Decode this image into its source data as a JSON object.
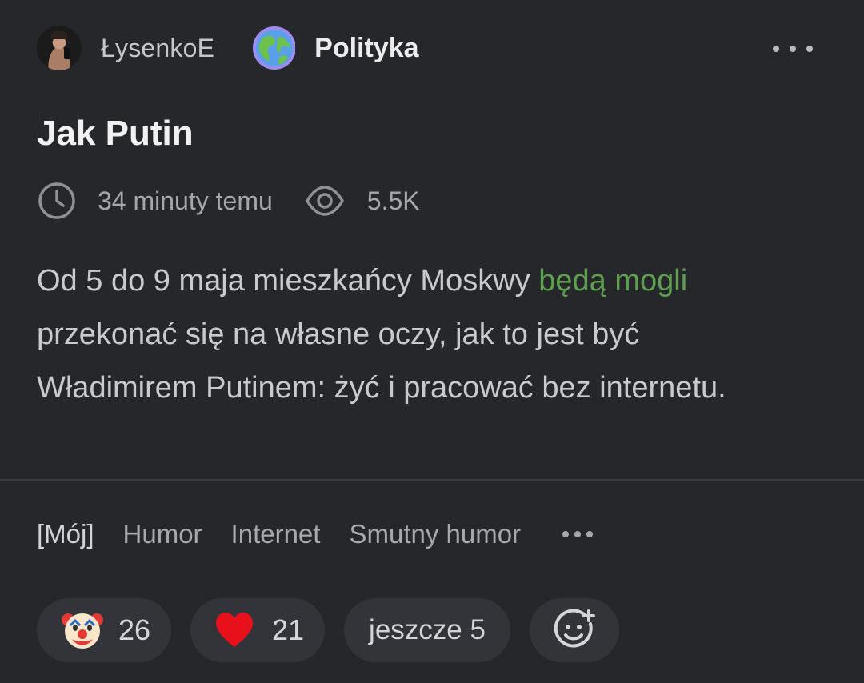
{
  "post": {
    "author": "ŁysenkoE",
    "community": "Polityka",
    "title": "Jak Putin",
    "time": "34 minuty temu",
    "views": "5.5K",
    "body": {
      "part1": "Od 5 do 9 maja mieszkańcy Moskwy ",
      "link": "będą mogli",
      "part2": " przekonać się na własne oczy, jak to jest być Władimirem Putinem: żyć i pracować bez internetu."
    },
    "colors": {
      "background": "#26272b",
      "link": "#5fa04e",
      "pill": "#33343a"
    }
  },
  "icons": {
    "avatar": "user-avatar",
    "community": "globe-icon",
    "menu": "more-icon",
    "time": "clock-icon",
    "views": "eye-icon",
    "add_reaction": "add-emoji-icon"
  },
  "tags": {
    "own": "[Mój]",
    "items": [
      "Humor",
      "Internet",
      "Smutny humor"
    ]
  },
  "reactions": {
    "clown": {
      "emoji": "clown-face",
      "count": "26"
    },
    "heart": {
      "emoji": "red-heart",
      "count": "21"
    },
    "more_label": "jeszcze 5"
  }
}
